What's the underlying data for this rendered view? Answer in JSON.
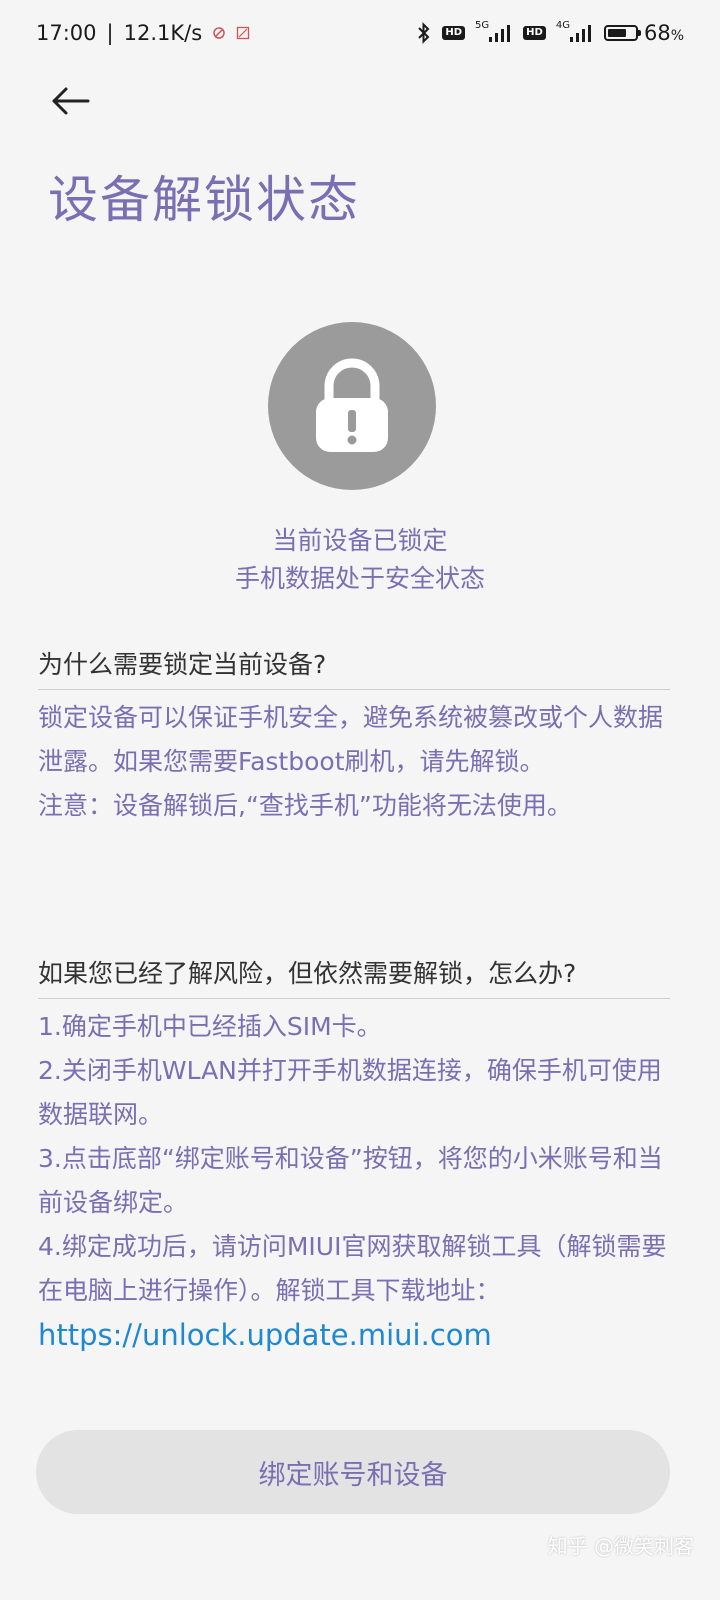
{
  "status_bar": {
    "time": "17:00",
    "net_speed": "12.1K/s",
    "hd": "HD",
    "net1": "5G",
    "net2": "4G",
    "battery_percent": "68",
    "battery_unit": "%",
    "battery_level": 68
  },
  "page": {
    "title": "设备解锁状态",
    "lock_status_line1": "当前设备已锁定",
    "lock_status_line2": "手机数据处于安全状态"
  },
  "section_why": {
    "title": "为什么需要锁定当前设备?",
    "body1": "锁定设备可以保证手机安全，避免系统被篡改或个人数据泄露。如果您需要Fastboot刷机，请先解锁。",
    "body2": "注意：设备解锁后,“查找手机”功能将无法使用。"
  },
  "section_how": {
    "title": "如果您已经了解风险，但依然需要解锁，怎么办?",
    "steps": [
      "1.确定手机中已经插入SIM卡。",
      "2.关闭手机WLAN并打开手机数据连接，确保手机可使用数据联网。",
      "3.点击底部“绑定账号和设备”按钮，将您的小米账号和当前设备绑定。",
      "4.绑定成功后，请访问MIUI官网获取解锁工具（解锁需要在电脑上进行操作）。解锁工具下载地址："
    ],
    "link": "https://unlock.update.miui.com"
  },
  "actions": {
    "bind_button": "绑定账号和设备"
  },
  "watermark": "知乎 @微笑刺客",
  "colors": {
    "accent": "#7b6fb3",
    "link": "#1e88d2",
    "lock_circle": "#9b9b9b"
  },
  "icons": {
    "back": "back-arrow-icon",
    "lock": "lock-warning-icon",
    "bluetooth": "bluetooth-icon",
    "battery": "battery-icon"
  }
}
